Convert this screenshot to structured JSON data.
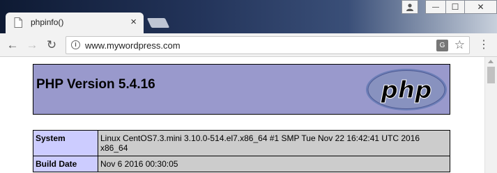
{
  "browser": {
    "tab": {
      "title": "phpinfo()",
      "close_label": "×"
    },
    "window_controls": {
      "user_label": "👤",
      "minimize_label": "—",
      "maximize_label": "☐",
      "close_label": "✕"
    },
    "toolbar": {
      "back_label": "←",
      "forward_label": "→",
      "reload_label": "↻",
      "url": "www.mywordpress.com",
      "star_label": "☆",
      "menu_label": "⋮"
    }
  },
  "page": {
    "heading": "PHP Version 5.4.16",
    "logo_text": "php",
    "rows": [
      {
        "label": "System",
        "value": "Linux CentOS7.3.mini 3.10.0-514.el7.x86_64 #1 SMP Tue Nov 22 16:42:41 UTC 2016 x86_64"
      },
      {
        "label": "Build Date",
        "value": "Nov 6 2016 00:30:05"
      }
    ]
  },
  "colors": {
    "header_bg": "#9999cc",
    "label_bg": "#ccccff",
    "value_bg": "#cccccc"
  }
}
